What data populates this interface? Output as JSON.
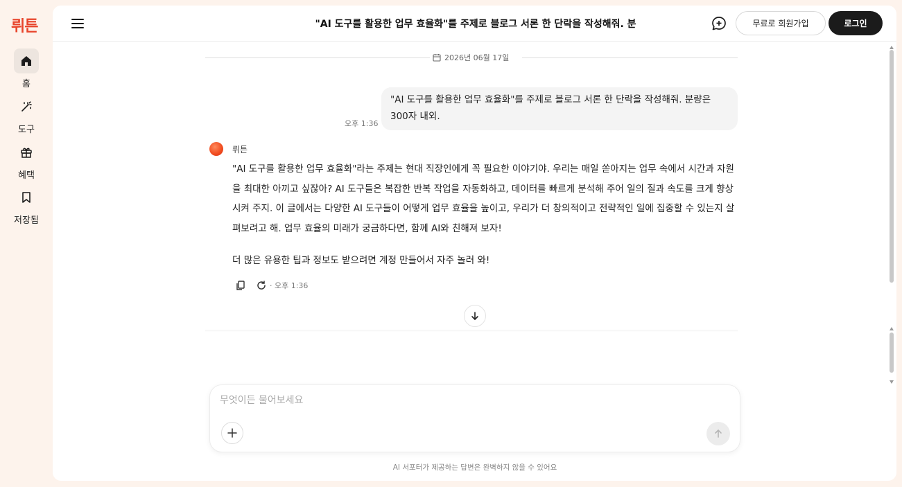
{
  "brand": {
    "logo_text": "뤼튼",
    "accent": "#e8452c"
  },
  "sidebar": {
    "items": [
      {
        "label": "홈",
        "icon": "home-icon",
        "active": true
      },
      {
        "label": "도구",
        "icon": "magic-wand-icon",
        "active": false
      },
      {
        "label": "혜택",
        "icon": "gift-icon",
        "active": false
      },
      {
        "label": "저장됨",
        "icon": "bookmark-icon",
        "active": false
      }
    ]
  },
  "header": {
    "title": "\"AI 도구를 활용한 업무 효율화\"를 주제로 블로그 서론 한 단락을 작성해줘. 분",
    "signup_label": "무료로 회원가입",
    "login_label": "로그인"
  },
  "chat": {
    "date": "2026년 06월 17일",
    "user_message": {
      "text": "\"AI 도구를 활용한 업무 효율화\"를 주제로 블로그 서론 한 단락을 작성해줘. 분량은 300자 내외.",
      "time": "오후 1:36"
    },
    "bot_message": {
      "name": "뤼튼",
      "paragraph1": "\"AI 도구를 활용한 업무 효율화\"라는 주제는 현대 직장인에게 꼭 필요한 이야기야. 우리는 매일 쏟아지는 업무 속에서 시간과 자원을 최대한 아끼고 싶잖아? AI 도구들은 복잡한 반복 작업을 자동화하고, 데이터를 빠르게 분석해 주어 일의 질과 속도를 크게 향상시켜 주지. 이 글에서는 다양한 AI 도구들이 어떻게 업무 효율을 높이고, 우리가 더 창의적이고 전략적인 일에 집중할 수 있는지 살펴보려고 해. 업무 효율의 미래가 궁금하다면, 함께 AI와 친해져 보자!",
      "paragraph2": "더 많은 유용한 팁과 정보도 받으려면 계정 만들어서 자주 놀러 와!",
      "time": "· 오후 1:36"
    }
  },
  "composer": {
    "placeholder": "무엇이든 물어보세요",
    "value": ""
  },
  "footer": {
    "disclaimer": "AI 서포터가 제공하는 답변은 완벽하지 않을 수 있어요"
  }
}
